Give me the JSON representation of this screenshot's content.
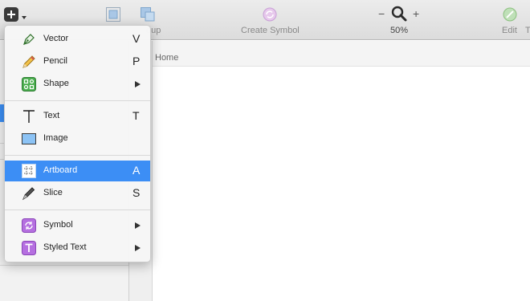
{
  "toolbar": {
    "insert_icon": "plus-icon",
    "group_label": "oup",
    "create_symbol_label": "Create Symbol",
    "zoom_label": "50%",
    "zoom_minus": "−",
    "zoom_plus": "+",
    "edit_label": "Edit",
    "edge_label": "T"
  },
  "canvas": {
    "artboard_name": "Home"
  },
  "menu": {
    "items": [
      {
        "label": "Vector",
        "shortcut": "V",
        "icon": "pen-icon"
      },
      {
        "label": "Pencil",
        "shortcut": "P",
        "icon": "pencil-icon"
      },
      {
        "label": "Shape",
        "shortcut": "",
        "icon": "shape-icon",
        "submenu": true
      },
      {
        "label": "Text",
        "shortcut": "T",
        "icon": "text-icon"
      },
      {
        "label": "Image",
        "shortcut": "",
        "icon": "image-icon"
      },
      {
        "label": "Artboard",
        "shortcut": "A",
        "icon": "artboard-icon",
        "selected": true
      },
      {
        "label": "Slice",
        "shortcut": "S",
        "icon": "slice-icon"
      },
      {
        "label": "Symbol",
        "shortcut": "",
        "icon": "symbol-icon",
        "submenu": true
      },
      {
        "label": "Styled Text",
        "shortcut": "",
        "icon": "styled-text-icon",
        "submenu": true
      }
    ]
  },
  "colors": {
    "selection": "#3c8ef5",
    "shape_green": "#4caf50",
    "symbol_purple": "#b56fe0",
    "image_blue": "#8cc3f5"
  }
}
